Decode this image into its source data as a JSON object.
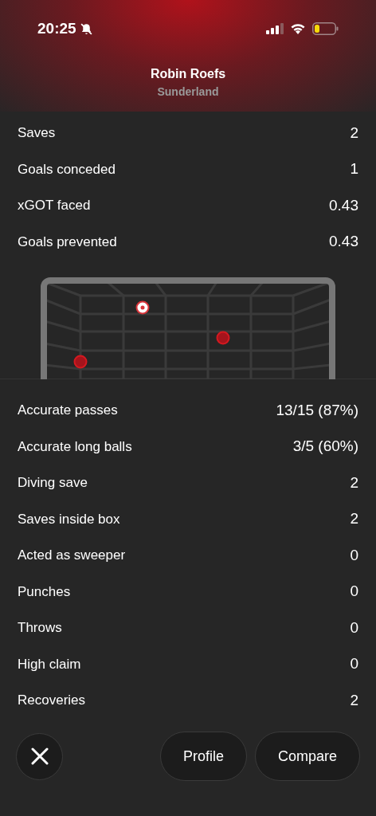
{
  "status_bar": {
    "time": "20:25",
    "silent": true
  },
  "header": {
    "player": "Robin Roefs",
    "team": "Sunderland"
  },
  "top_stats": [
    {
      "label": "Saves",
      "value": "2"
    },
    {
      "label": "Goals conceded",
      "value": "1"
    },
    {
      "label": "xGOT faced",
      "value": "0.43"
    },
    {
      "label": "Goals prevented",
      "value": "0.43"
    }
  ],
  "shot_map": {
    "shots": [
      {
        "kind": "goal"
      },
      {
        "kind": "saved"
      },
      {
        "kind": "saved"
      }
    ]
  },
  "stats": [
    {
      "label": "Accurate passes",
      "value": "13/15 (87%)"
    },
    {
      "label": "Accurate long balls",
      "value": "3/5 (60%)"
    },
    {
      "label": "Diving save",
      "value": "2"
    },
    {
      "label": "Saves inside box",
      "value": "2"
    },
    {
      "label": "Acted as sweeper",
      "value": "0"
    },
    {
      "label": "Punches",
      "value": "0"
    },
    {
      "label": "Throws",
      "value": "0"
    },
    {
      "label": "High claim",
      "value": "0"
    },
    {
      "label": "Recoveries",
      "value": "2"
    }
  ],
  "buttons": [
    "Profile",
    "Compare"
  ]
}
